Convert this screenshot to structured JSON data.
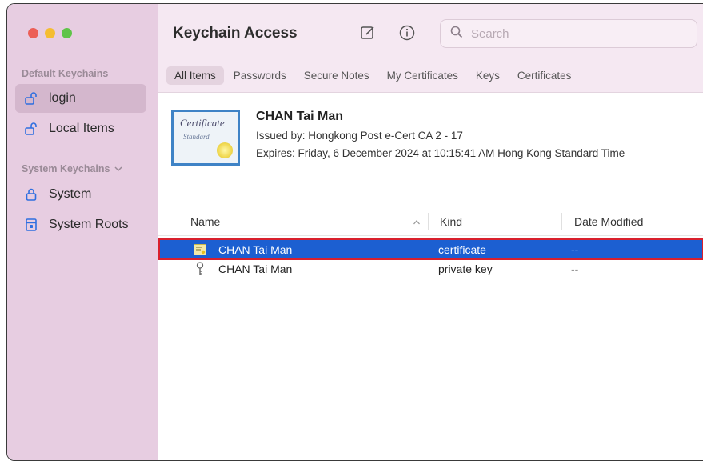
{
  "app": {
    "title": "Keychain Access"
  },
  "sidebar": {
    "default_label": "Default Keychains",
    "system_label": "System Keychains",
    "items": [
      {
        "label": "login",
        "icon": "lock-open-icon"
      },
      {
        "label": "Local Items",
        "icon": "lock-open-icon"
      },
      {
        "label": "System",
        "icon": "lock-icon"
      },
      {
        "label": "System Roots",
        "icon": "cabinet-icon"
      }
    ]
  },
  "toolbar": {
    "search_placeholder": "Search"
  },
  "tabs": [
    {
      "label": "All Items",
      "active": true
    },
    {
      "label": "Passwords"
    },
    {
      "label": "Secure Notes"
    },
    {
      "label": "My Certificates"
    },
    {
      "label": "Keys"
    },
    {
      "label": "Certificates"
    }
  ],
  "certificate": {
    "name": "CHAN Tai Man",
    "issued_by": "Issued by: Hongkong Post e-Cert CA 2 - 17",
    "expires": "Expires: Friday, 6 December 2024 at 10:15:41 AM Hong Kong Standard Time",
    "image_text_1": "Certificate",
    "image_text_2": "Standard"
  },
  "table": {
    "columns": {
      "name": "Name",
      "kind": "Kind",
      "date": "Date Modified"
    },
    "rows": [
      {
        "name": "CHAN Tai Man",
        "kind": "certificate",
        "date": "--",
        "icon": "certificate-icon",
        "selected": true
      },
      {
        "name": "CHAN Tai Man",
        "kind": "private key",
        "date": "--",
        "icon": "key-icon"
      }
    ]
  },
  "colors": {
    "sidebar_bg": "#e7cde1",
    "selection_blue": "#1c5fd1",
    "highlight_red": "#d9202d"
  }
}
